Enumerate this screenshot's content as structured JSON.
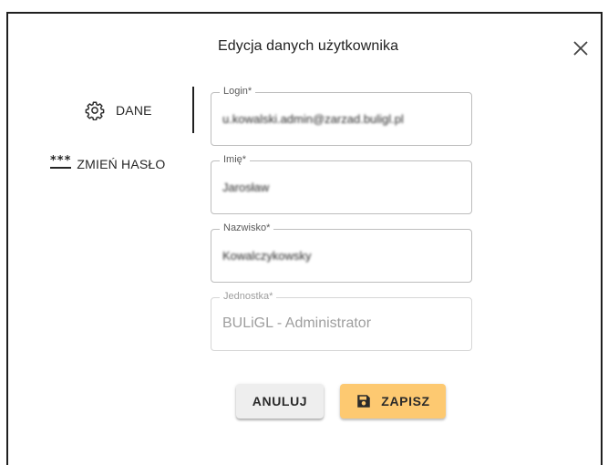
{
  "dialog": {
    "title": "Edycja danych użytkownika",
    "close_icon": "close-icon"
  },
  "nav": {
    "items": [
      {
        "label": "DANE",
        "icon": "gear-icon",
        "active": true
      },
      {
        "label": "ZMIEŃ HASŁO",
        "icon": "password-icon",
        "icon_text": "***",
        "active": false
      }
    ]
  },
  "form": {
    "login": {
      "label": "Login*",
      "value": "u.kowalski.admin@zarzad.buligl.pl"
    },
    "imie": {
      "label": "Imię*",
      "value": "Jarosław"
    },
    "nazwisko": {
      "label": "Nazwisko*",
      "value": "Kowalczykowsky"
    },
    "jednostka": {
      "label": "Jednostka*",
      "value": "BULiGL - Administrator",
      "disabled": true
    }
  },
  "buttons": {
    "cancel_label": "ANULUJ",
    "save_label": "ZAPISZ",
    "save_icon": "floppy-disk-icon"
  },
  "colors": {
    "accent_save": "#fdc971",
    "cancel_bg": "#eeeeee",
    "border": "#bdbdbd"
  }
}
